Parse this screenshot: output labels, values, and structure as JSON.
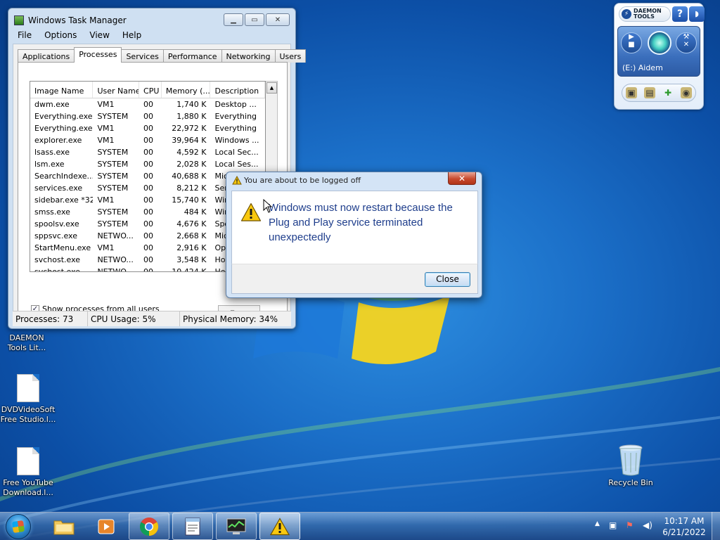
{
  "task_manager": {
    "title": "Windows Task Manager",
    "menu": [
      "File",
      "Options",
      "View",
      "Help"
    ],
    "tabs": [
      "Applications",
      "Processes",
      "Services",
      "Performance",
      "Networking",
      "Users"
    ],
    "active_tab": "Processes",
    "columns": [
      "Image Name",
      "User Name",
      "CPU",
      "Memory (...",
      "Description"
    ],
    "rows": [
      [
        "dwm.exe",
        "VM1",
        "00",
        "1,740 K",
        "Desktop ..."
      ],
      [
        "Everything.exe",
        "SYSTEM",
        "00",
        "1,880 K",
        "Everything"
      ],
      [
        "Everything.exe",
        "VM1",
        "00",
        "22,972 K",
        "Everything"
      ],
      [
        "explorer.exe",
        "VM1",
        "00",
        "39,964 K",
        "Windows ..."
      ],
      [
        "lsass.exe",
        "SYSTEM",
        "00",
        "4,592 K",
        "Local Sec..."
      ],
      [
        "lsm.exe",
        "SYSTEM",
        "00",
        "2,028 K",
        "Local Ses..."
      ],
      [
        "SearchIndexe...",
        "SYSTEM",
        "00",
        "40,688 K",
        "Microsoft ..."
      ],
      [
        "services.exe",
        "SYSTEM",
        "00",
        "8,212 K",
        "Ser"
      ],
      [
        "sidebar.exe *32",
        "VM1",
        "00",
        "15,740 K",
        "Win"
      ],
      [
        "smss.exe",
        "SYSTEM",
        "00",
        "484 K",
        "Win"
      ],
      [
        "spoolsv.exe",
        "SYSTEM",
        "00",
        "4,676 K",
        "Spo"
      ],
      [
        "sppsvc.exe",
        "NETWO...",
        "00",
        "2,668 K",
        "Mic"
      ],
      [
        "StartMenu.exe",
        "VM1",
        "00",
        "2,916 K",
        "Ope"
      ],
      [
        "svchost.exe",
        "NETWO...",
        "00",
        "3,548 K",
        "Hos"
      ],
      [
        "svchost.exe",
        "NETWO...",
        "00",
        "10,424 K",
        "Hos"
      ]
    ],
    "show_all_label": "Show processes from all users",
    "show_all_checked": "✓",
    "end_process_label": "E",
    "status": {
      "processes": "Processes: 73",
      "cpu": "CPU Usage: 5%",
      "memory": "Physical Memory: 34%"
    }
  },
  "dialog": {
    "title": "You are about to be logged off",
    "message": "Windows must now restart because the Plug and Play service terminated unexpectedly",
    "close_label": "Close",
    "close_x": "✕"
  },
  "daemon_tools": {
    "logo_line1": "DAEMON",
    "logo_line2": "TOOLS",
    "help": "?",
    "drive_label": "(E:) Aidem"
  },
  "desktop_icons": [
    {
      "line1": "DAEMON",
      "line2": "Tools Lit..."
    },
    {
      "line1": "DVDVideoSoft",
      "line2": "Free Studio.l..."
    },
    {
      "line1": "Free YouTube",
      "line2": "Download.l..."
    },
    {
      "line1": "Recycle Bin",
      "line2": ""
    }
  ],
  "clock": {
    "time": "10:17 AM",
    "date": "6/21/2022"
  },
  "colors": {
    "dialog_text": "#1f3e8c",
    "desktop_blue": "#1b6fc8"
  }
}
